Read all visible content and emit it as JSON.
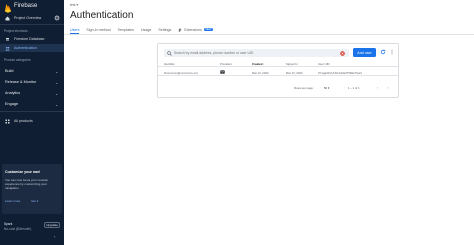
{
  "sidebar": {
    "brand": "Firebase",
    "overview": "Project Overview",
    "shortcuts_section": "Project shortcuts",
    "shortcuts": [
      {
        "label": "Firestore Database",
        "icon": "database-icon"
      },
      {
        "label": "Authentication",
        "icon": "people-icon"
      }
    ],
    "categories_section": "Product categories",
    "categories": [
      "Build",
      "Release & Monitor",
      "Analytics",
      "Engage"
    ],
    "all_products": "All products",
    "customize": {
      "title": "Customize your nav!",
      "text": "You can now focus your console experience by customizing your navigation",
      "learn_more": "Learn more",
      "got_it": "Got it"
    },
    "plan": {
      "name": "Spark",
      "sub": "No-cost ($0/month)",
      "upgrade": "Upgrade"
    }
  },
  "header": {
    "project": "test",
    "title": "Authentication"
  },
  "tabs": [
    {
      "label": "Users",
      "selected": true
    },
    {
      "label": "Sign-in method",
      "selected": false
    },
    {
      "label": "Templates",
      "selected": false
    },
    {
      "label": "Usage",
      "selected": false
    },
    {
      "label": "Settings",
      "selected": false
    },
    {
      "label": "Extensions",
      "selected": false,
      "badge": "NEW"
    }
  ],
  "users": {
    "search_placeholder": "Search by email address, phone number or user UID",
    "add_user": "Add user",
    "columns": [
      "Identifier",
      "Providers",
      "Created",
      "Signed In",
      "User UID"
    ],
    "rows": [
      {
        "identifier": "firsxxxxxxx@xxxxxxxxx.xxx",
        "provider_icon": "mail-icon",
        "created": "Mar 13, 2023",
        "signed_in": "Mar 13, 2023",
        "uid": "0Y1gaOFzUU6L4rHG0TW8oXSur2"
      }
    ],
    "pagination": {
      "rows_label": "Rows per page:",
      "rows_value": "50",
      "range": "1 – 1 of 1"
    }
  },
  "colors": {
    "sidebar": "#0f1e33",
    "accent": "#1a73e8",
    "active_text": "#8ab4f8"
  }
}
